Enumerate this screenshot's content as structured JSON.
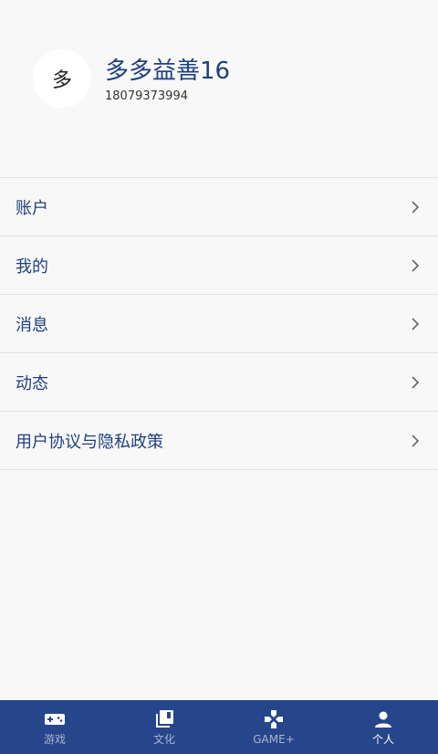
{
  "profile": {
    "avatar_text": "多",
    "name": "多多益善16",
    "phone": "18079373994"
  },
  "menu": {
    "items": [
      {
        "label": "账户"
      },
      {
        "label": "我的"
      },
      {
        "label": "消息"
      },
      {
        "label": "动态"
      },
      {
        "label": "用户协议与隐私政策"
      }
    ]
  },
  "tabbar": {
    "tabs": [
      {
        "label": "游戏",
        "icon": "gamepad-icon",
        "active": false
      },
      {
        "label": "文化",
        "icon": "library-icon",
        "active": false
      },
      {
        "label": "GAME+",
        "icon": "dpad-icon",
        "active": false
      },
      {
        "label": "个人",
        "icon": "person-icon",
        "active": true
      }
    ]
  },
  "colors": {
    "accent": "#1f3f7c",
    "tabbar_bg": "#27458a",
    "tab_inactive": "#a9b6d2",
    "tab_active": "#ffffff",
    "background": "#f8f8f8"
  }
}
